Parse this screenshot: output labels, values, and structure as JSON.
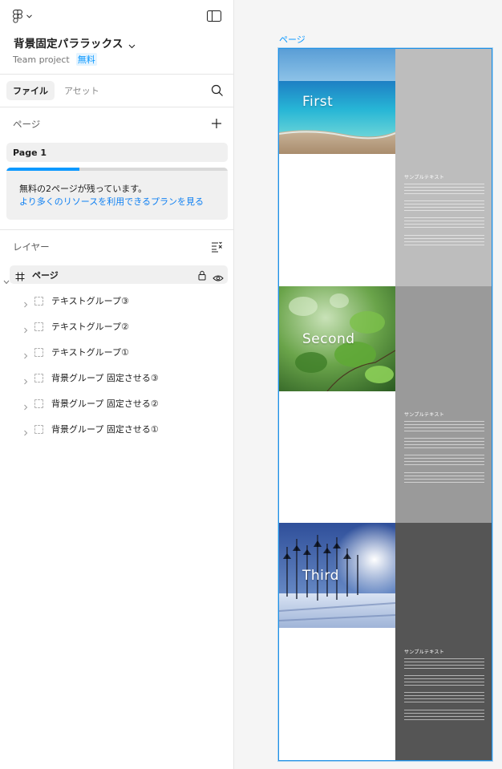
{
  "app": {
    "file_title": "背景固定パララックス",
    "project": "Team project",
    "plan_badge": "無料",
    "accent_color": "#0d99ff"
  },
  "tabs": [
    {
      "label": "ファイル",
      "active": true
    },
    {
      "label": "アセット",
      "active": false
    }
  ],
  "pages_section": {
    "title": "ページ",
    "items": [
      {
        "label": "Page 1",
        "selected": true
      }
    ]
  },
  "upsell": {
    "progress": 0.33,
    "message": "無料の2ページが残っています。",
    "link": "より多くのリソースを利用できるプランを見る"
  },
  "layers_section": {
    "title": "レイヤー",
    "root": {
      "label": "ページ",
      "icon": "frame-icon"
    },
    "items": [
      {
        "label": "テキストグループ③"
      },
      {
        "label": "テキストグループ②"
      },
      {
        "label": "テキストグループ①"
      },
      {
        "label": "背景グループ 固定させる③"
      },
      {
        "label": "背景グループ 固定させる②"
      },
      {
        "label": "背景グループ 固定させる①"
      }
    ]
  },
  "canvas": {
    "frame_label": "ページ",
    "selection_color": "#1e90e6",
    "sections": [
      {
        "title": "First",
        "sample_title": "サンプルテキスト",
        "side_color": "#bdbdbd",
        "image": "beach"
      },
      {
        "title": "Second",
        "sample_title": "サンプルテキスト",
        "side_color": "#9a9a9a",
        "image": "leaves"
      },
      {
        "title": "Third",
        "sample_title": "サンプルテキスト",
        "side_color": "#555555",
        "image": "winter-forest"
      }
    ]
  }
}
